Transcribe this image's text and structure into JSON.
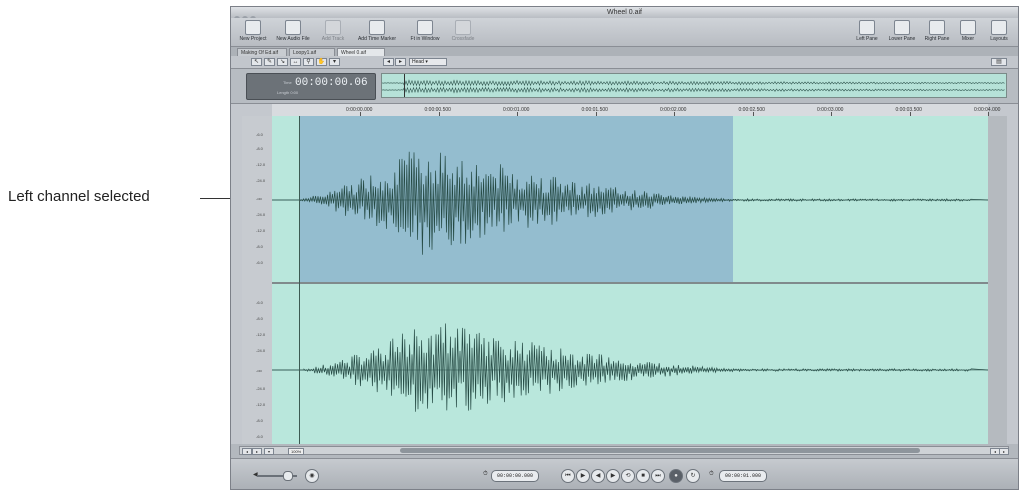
{
  "callout": {
    "label": "Left channel selected"
  },
  "window": {
    "title": "Wheel 0.aif"
  },
  "toolbar": {
    "left": [
      {
        "label": "New Project",
        "icon": "new-project-icon",
        "enabled": true
      },
      {
        "label": "New Audio File",
        "icon": "new-audio-file-icon",
        "enabled": true
      },
      {
        "label": "Add Track",
        "icon": "add-track-icon",
        "enabled": false
      },
      {
        "label": "Add Time Marker",
        "icon": "marker-icon",
        "enabled": true
      },
      {
        "label": "Ft in Window",
        "icon": "fit-window-icon",
        "enabled": true
      },
      {
        "label": "Crossfade",
        "icon": "crossfade-icon",
        "enabled": false
      }
    ],
    "right": [
      {
        "label": "Left Pane",
        "icon": "left-pane-icon"
      },
      {
        "label": "Lower Pane",
        "icon": "lower-pane-icon"
      },
      {
        "label": "Right Pane",
        "icon": "right-pane-icon"
      },
      {
        "label": "Mixer",
        "icon": "mixer-icon"
      },
      {
        "label": "Layouts",
        "icon": "layouts-icon"
      }
    ]
  },
  "tabs": [
    {
      "label": "Making Of Ed.aif",
      "active": false
    },
    {
      "label": "Loopy1.aif",
      "active": false
    },
    {
      "label": "Wheel 0.aif",
      "active": true
    }
  ],
  "subbar": {
    "view_select": "Head"
  },
  "overview": {
    "timecode": "00:00:00.06",
    "tc_label": "Time",
    "tc_sub": "Length 0:00"
  },
  "ruler": {
    "ticks": [
      "0:00:00.000",
      "0:00:00.500",
      "0:00:01.000",
      "0:00:01.500",
      "0:00:02.000",
      "0:00:02.500",
      "0:00:03.000",
      "0:00:03.500",
      "0:00:04.000"
    ]
  },
  "scale": {
    "left": [
      "-6.0",
      "-8.0",
      "-12.0",
      "-24.0",
      "-oo",
      "-24.0",
      "-12.0",
      "-8.0",
      "-6.0"
    ],
    "right": [
      "-6.0",
      "-8.0",
      "-12.0",
      "-24.0",
      "-oo",
      "-24.0",
      "-12.0",
      "-8.0",
      "-6.0"
    ]
  },
  "bottom": {
    "zoom": "100%"
  },
  "transport": {
    "start_tc": "00:00:00.000",
    "end_tc": "00:00:01.000",
    "buttons": [
      "rewind-icon",
      "play-icon",
      "prev-icon",
      "next-icon",
      "loop-icon",
      "stop-icon",
      "forward-icon",
      "end-icon",
      "record-icon",
      "cycle-icon"
    ]
  }
}
